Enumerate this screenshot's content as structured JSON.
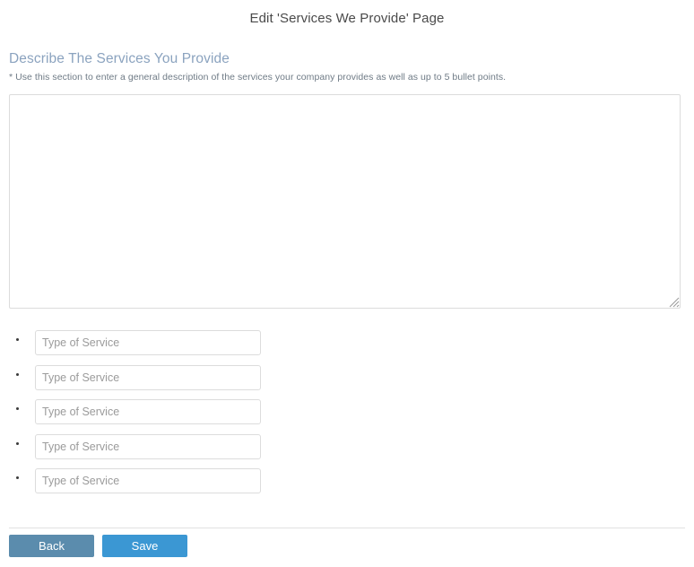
{
  "header": {
    "title": "Edit 'Services We Provide' Page"
  },
  "section": {
    "heading": "Describe The Services You Provide",
    "note": "* Use this section to enter a general description of the services your company provides as well as up to 5 bullet points.",
    "description_value": "",
    "description_placeholder": ""
  },
  "bullets": [
    {
      "placeholder": "Type of Service",
      "value": ""
    },
    {
      "placeholder": "Type of Service",
      "value": ""
    },
    {
      "placeholder": "Type of Service",
      "value": ""
    },
    {
      "placeholder": "Type of Service",
      "value": ""
    },
    {
      "placeholder": "Type of Service",
      "value": ""
    }
  ],
  "footer": {
    "back_label": "Back",
    "save_label": "Save"
  },
  "colors": {
    "heading": "#8ba3bf",
    "title": "#4a4a4a",
    "note": "#6f7b86",
    "back_button": "#5b8cad",
    "save_button": "#3b97d3",
    "border": "#dcdcdc",
    "divider": "#e2e2e2",
    "placeholder": "#9b9b9b"
  },
  "icons": {
    "resize_grip": "resize-grip-icon",
    "bullet": "bullet-dot-icon"
  }
}
